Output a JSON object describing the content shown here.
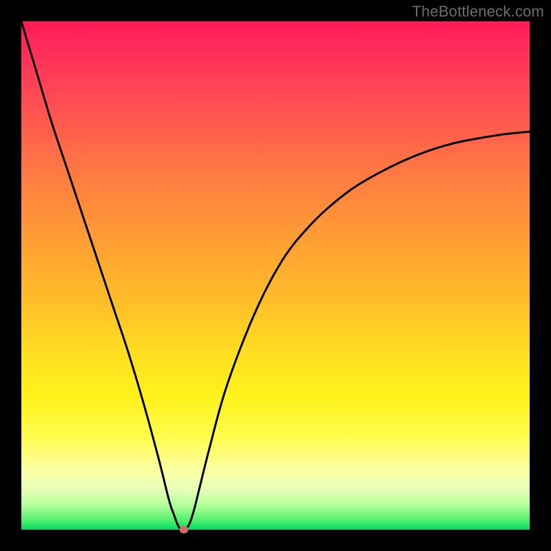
{
  "watermark": "TheBottleneck.com",
  "chart_data": {
    "type": "line",
    "title": "",
    "xlabel": "",
    "ylabel": "",
    "xlim": [
      0,
      100
    ],
    "ylim": [
      0,
      100
    ],
    "series": [
      {
        "name": "bottleneck-curve",
        "x": [
          0,
          3,
          6,
          9,
          12,
          15,
          18,
          21,
          24,
          27,
          29,
          30,
          31,
          32,
          33,
          34,
          35,
          37,
          40,
          44,
          48,
          52,
          56,
          60,
          65,
          70,
          75,
          80,
          85,
          90,
          95,
          100
        ],
        "y": [
          100,
          90,
          80,
          71,
          62,
          53,
          44,
          35,
          25,
          14,
          6,
          3,
          0.5,
          0,
          1,
          4,
          8,
          16,
          27,
          38,
          47,
          54,
          59,
          63,
          67,
          70,
          72.5,
          74.5,
          76,
          77,
          77.8,
          78.3
        ]
      }
    ],
    "marker": {
      "x": 32,
      "y": 0
    },
    "gradient_stops": [
      {
        "pos": 0,
        "color": "#ff1a58"
      },
      {
        "pos": 50,
        "color": "#ffb030"
      },
      {
        "pos": 80,
        "color": "#fff21c"
      },
      {
        "pos": 100,
        "color": "#00dc60"
      }
    ]
  }
}
